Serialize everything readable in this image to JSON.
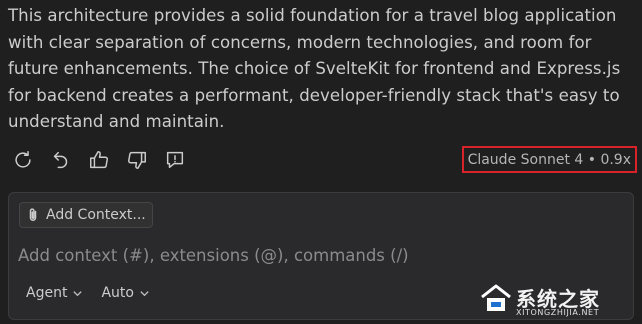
{
  "response": {
    "text": "This architecture provides a solid foundation for a travel blog application with clear separation of concerns, modern technologies, and room for future enhancements. The choice of SvelteKit for frontend and Express.js for backend creates a performant, developer-friendly stack that's easy to understand and maintain."
  },
  "actions": {
    "icons": [
      "refresh-icon",
      "undo-icon",
      "thumbs-up-icon",
      "thumbs-down-icon",
      "report-icon"
    ]
  },
  "model_badge": {
    "label": "Claude Sonnet 4 • 0.9x",
    "highlight_color": "#d8232a"
  },
  "composer": {
    "add_context_label": "Add Context...",
    "input_placeholder": "Add context (#), extensions (@), commands (/)",
    "input_value": "",
    "mode_label": "Agent",
    "model_select_label": "Auto"
  },
  "watermark": {
    "title": "系统之家",
    "url": "XITONGZHIJIA.NET"
  },
  "colors": {
    "background": "#1f1f1f",
    "composer_background": "#2a2a2c",
    "text": "#cccccc",
    "placeholder": "#8b8b8b"
  }
}
